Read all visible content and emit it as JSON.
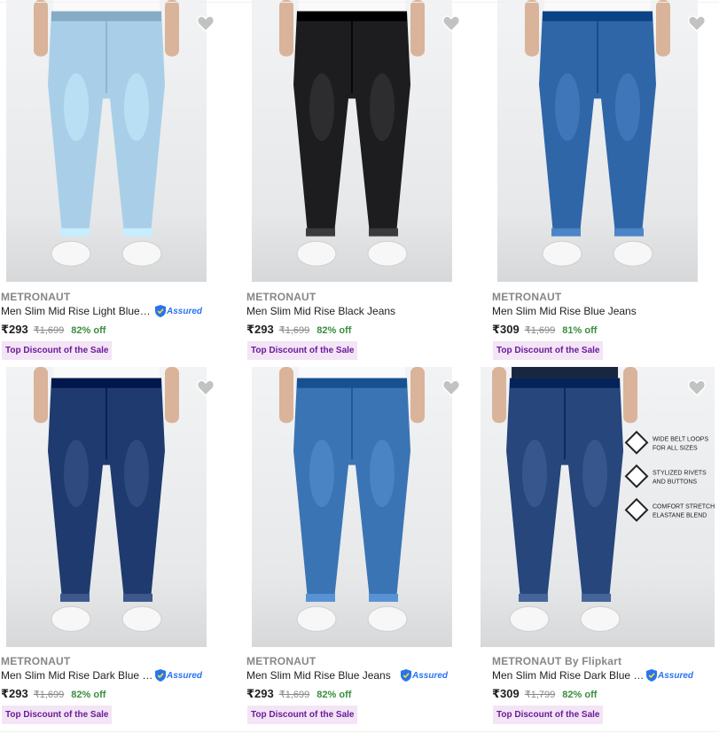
{
  "accent_color": "#2874f0",
  "products": [
    {
      "brand": "METRONAUT",
      "title": "Men Slim Mid Rise Light Blue Je...",
      "assured": true,
      "assured_label": "Assured",
      "price": "₹293",
      "mrp": "₹1,699",
      "discount": "82% off",
      "tag": "Top Discount of the Sale",
      "jeans_color": "#a9cfe8",
      "icon": "heart-icon"
    },
    {
      "brand": "METRONAUT",
      "title": "Men Slim Mid Rise Black Jeans",
      "assured": false,
      "price": "₹293",
      "mrp": "₹1,699",
      "discount": "82% off",
      "tag": "Top Discount of the Sale",
      "jeans_color": "#1d1d1f",
      "icon": "heart-icon"
    },
    {
      "brand": "METRONAUT",
      "title": "Men Slim Mid Rise Blue Jeans",
      "assured": false,
      "price": "₹309",
      "mrp": "₹1,699",
      "discount": "81% off",
      "tag": "Top Discount of the Sale",
      "jeans_color": "#2f66a8",
      "icon": "heart-icon"
    },
    {
      "brand": "METRONAUT",
      "title": "Men Slim Mid Rise Dark Blue Je...",
      "assured": true,
      "assured_label": "Assured",
      "price": "₹293",
      "mrp": "₹1,699",
      "discount": "82% off",
      "tag": "Top Discount of the Sale",
      "jeans_color": "#1f3a6e",
      "icon": "heart-icon"
    },
    {
      "brand": "METRONAUT",
      "title": "Men Slim Mid Rise Blue Jeans",
      "assured": true,
      "assured_label": "Assured",
      "price": "₹293",
      "mrp": "₹1,699",
      "discount": "82% off",
      "tag": "Top Discount of the Sale",
      "jeans_color": "#3a74b4",
      "icon": "heart-icon"
    },
    {
      "brand": "METRONAUT By Flipkart",
      "title": "Men Slim Mid Rise Dark Blue Je...",
      "assured": true,
      "assured_label": "Assured",
      "price": "₹309",
      "mrp": "₹1,799",
      "discount": "82% off",
      "tag": "Top Discount of the Sale",
      "jeans_color": "#26467c",
      "icon": "heart-icon",
      "features": [
        "WIDE BELT LOOPS FOR ALL SIZES",
        "STYLIZED RIVETS AND BUTTONS",
        "COMFORT STRETCH WITH ELASTANE BLEND"
      ]
    }
  ]
}
